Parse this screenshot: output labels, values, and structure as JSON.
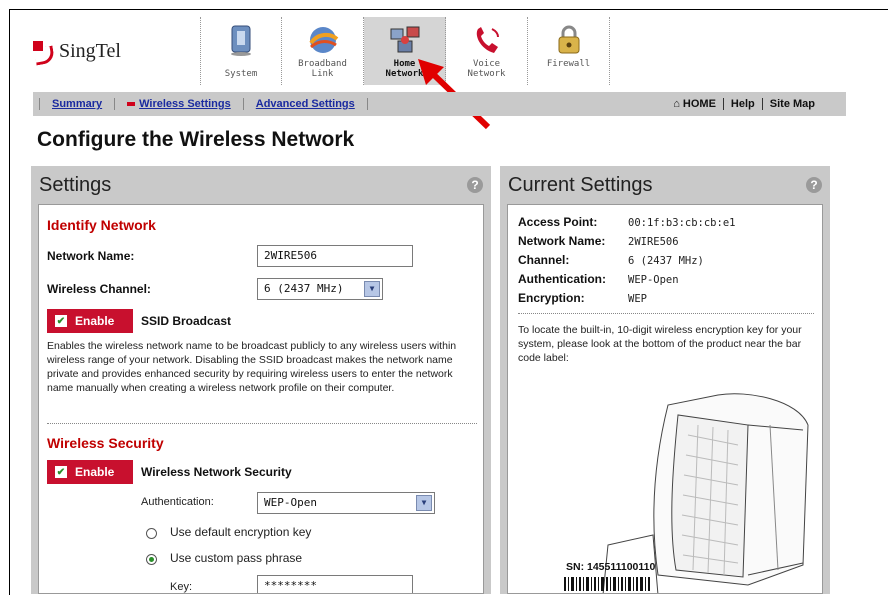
{
  "brand": {
    "name": "SingTel"
  },
  "nav": {
    "items": [
      {
        "label1": "",
        "label2": "System",
        "icon": "system-icon"
      },
      {
        "label1": "Broadband",
        "label2": "Link",
        "icon": "broadband-link-icon"
      },
      {
        "label1": "Home",
        "label2": "Network",
        "icon": "home-network-icon",
        "active": true
      },
      {
        "label1": "Voice",
        "label2": "Network",
        "icon": "voice-network-icon"
      },
      {
        "label1": "Firewall",
        "label2": "",
        "icon": "firewall-icon"
      }
    ]
  },
  "subnav": {
    "summary": "Summary",
    "wireless": "Wireless Settings",
    "advanced": "Advanced Settings",
    "home": "HOME",
    "help": "Help",
    "sitemap": "Site Map"
  },
  "page": {
    "title": "Configure the Wireless Network"
  },
  "settings": {
    "title": "Settings",
    "help_glyph": "?",
    "identify_title": "Identify Network",
    "network_name_label": "Network Name:",
    "network_name_value": "2WIRE506",
    "channel_label": "Wireless Channel:",
    "channel_value": "6 (2437 MHz)",
    "enable_label": "Enable",
    "ssid_label": "SSID Broadcast",
    "ssid_desc": "Enables the wireless network name to be broadcast publicly to any wireless users within wireless range of your network. Disabling the SSID broadcast makes the network name private and provides enhanced security by requiring wireless users to enter the network name manually when creating a wireless network profile on their computer.",
    "security_title": "Wireless Security",
    "security_enable_label": "Enable",
    "security_label": "Wireless Network Security",
    "auth_label": "Authentication:",
    "auth_value": "WEP-Open",
    "radio_default": "Use default encryption key",
    "radio_custom": "Use custom pass phrase",
    "key_label": "Key:",
    "key_value": "********"
  },
  "current": {
    "title": "Current Settings",
    "help_glyph": "?",
    "rows": [
      {
        "k": "Access Point:",
        "v": "00:1f:b3:cb:cb:e1"
      },
      {
        "k": "Network Name:",
        "v": "2WIRE506"
      },
      {
        "k": "Channel:",
        "v": "6 (2437 MHz)"
      },
      {
        "k": "Authentication:",
        "v": "WEP-Open"
      },
      {
        "k": "Encryption:",
        "v": "WEP"
      }
    ],
    "note": "To locate the built-in, 10-digit wireless encryption key for your system, please look at the bottom of the product near the bar code label:",
    "serial": "SN: 145511100110"
  }
}
